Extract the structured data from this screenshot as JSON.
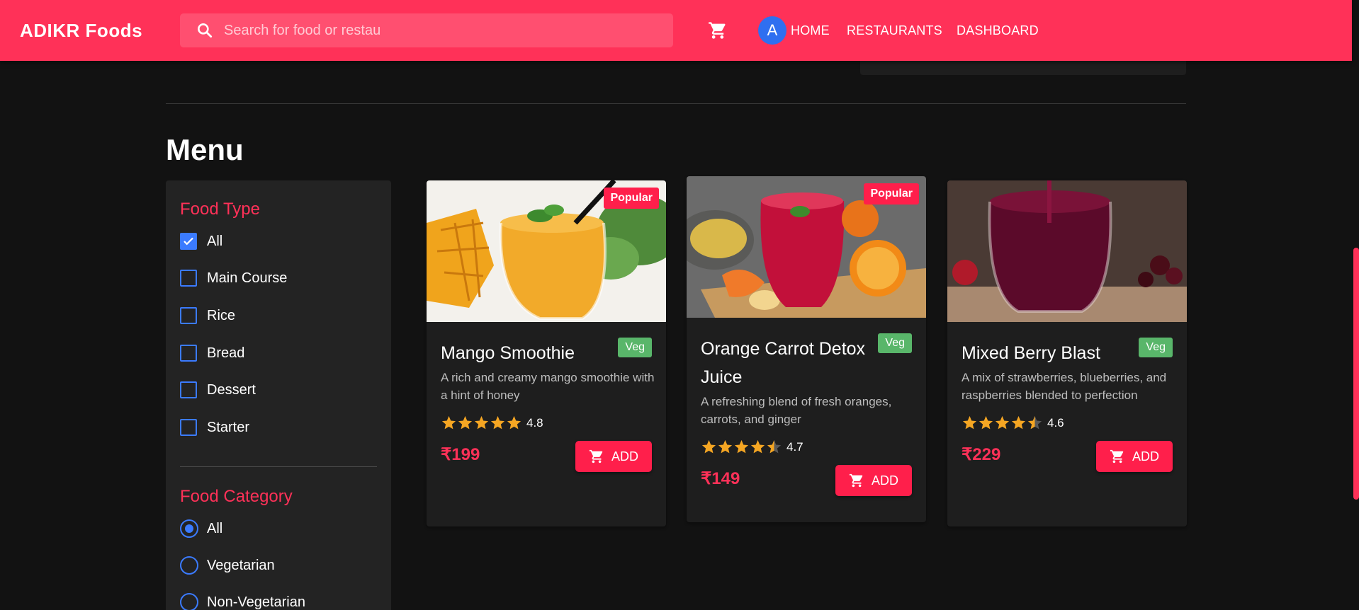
{
  "header": {
    "brand": "ADIKR Foods",
    "search_placeholder": "Search for food or restau",
    "avatar_letter": "A",
    "nav": [
      "HOME",
      "RESTAURANTS",
      "DASHBOARD"
    ],
    "icons": [
      "search-icon",
      "cart-icon"
    ]
  },
  "menu": {
    "title": "Menu"
  },
  "filters": {
    "food_type": {
      "title": "Food Type",
      "options": [
        "All",
        "Main Course",
        "Rice",
        "Bread",
        "Dessert",
        "Starter"
      ],
      "checked": [
        "All"
      ]
    },
    "food_category": {
      "title": "Food Category",
      "options": [
        "All",
        "Vegetarian",
        "Non-Vegetarian"
      ],
      "selected": "All"
    }
  },
  "items": [
    {
      "name": "Mango Smoothie",
      "badge": "Veg",
      "popular": "Popular",
      "description": "A rich and creamy mango smoothie with a hint of honey",
      "rating": "4.8",
      "rating_value": 4.8,
      "price": "₹199",
      "add_label": "ADD"
    },
    {
      "name": "Orange Carrot Detox Juice",
      "badge": "Veg",
      "popular": "Popular",
      "description": "A refreshing blend of fresh oranges, carrots, and ginger",
      "rating": "4.7",
      "rating_value": 4.7,
      "price": "₹149",
      "add_label": "ADD"
    },
    {
      "name": "Mixed Berry Blast",
      "badge": "Veg",
      "description": "A mix of strawberries, blueberries, and raspberries blended to perfection",
      "rating": "4.6",
      "rating_value": 4.6,
      "price": "₹229",
      "add_label": "ADD"
    }
  ],
  "colors": {
    "brand": "#ff3158",
    "accent_blue": "#3b7bff",
    "veg": "#59b66a",
    "star": "#f5a623",
    "background": "#121212"
  }
}
